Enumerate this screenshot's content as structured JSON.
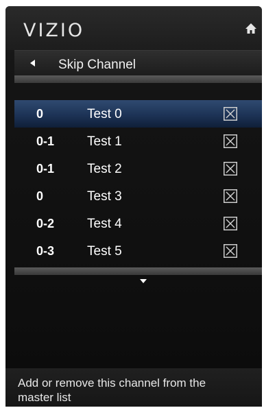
{
  "header": {
    "logo": "VIZIO",
    "home_icon": "home-icon"
  },
  "title_bar": {
    "back_icon": "back-arrow-icon",
    "title": "Skip Channel"
  },
  "channels": [
    {
      "number": "0",
      "name": "Test 0",
      "skipped": true,
      "selected": true
    },
    {
      "number": "0-1",
      "name": "Test 1",
      "skipped": true,
      "selected": false
    },
    {
      "number": "0-1",
      "name": "Test 2",
      "skipped": true,
      "selected": false
    },
    {
      "number": "0",
      "name": "Test 3",
      "skipped": true,
      "selected": false
    },
    {
      "number": "0-2",
      "name": "Test 4",
      "skipped": true,
      "selected": false
    },
    {
      "number": "0-3",
      "name": "Test 5",
      "skipped": true,
      "selected": false
    }
  ],
  "scroll_icon": "chevron-down-icon",
  "footer": {
    "help_text": "Add or remove this channel from the master list"
  },
  "colors": {
    "selected_row": "#1d3356",
    "checkbox": "#cfcfcf"
  }
}
